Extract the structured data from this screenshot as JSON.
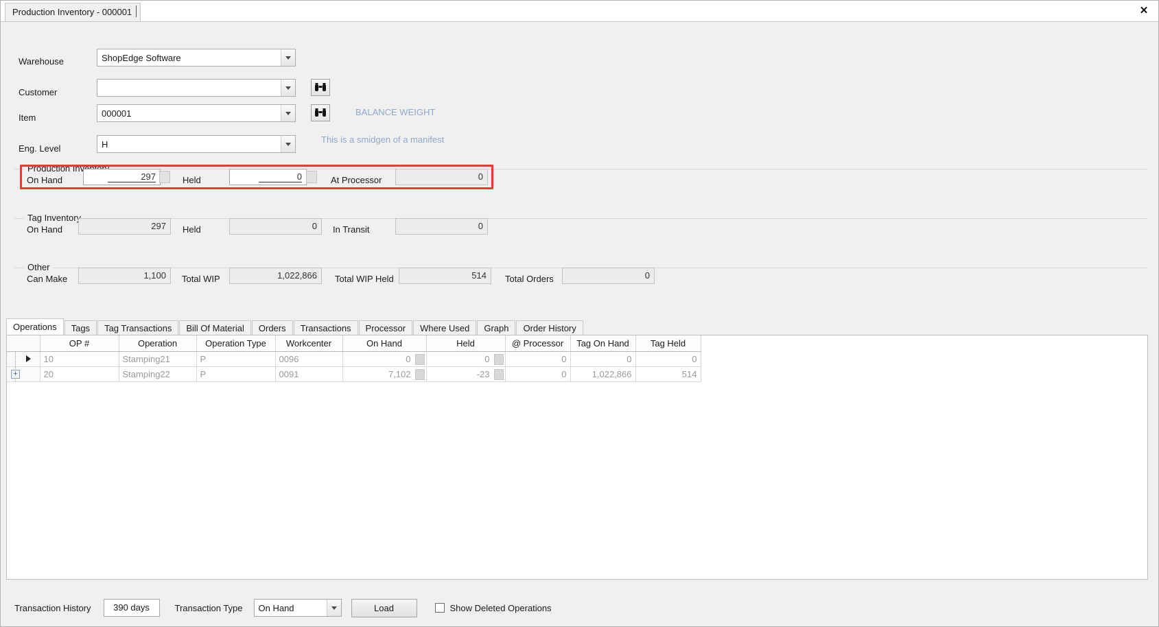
{
  "window": {
    "tab_title": "Production Inventory - 000001",
    "close_icon": "close-icon"
  },
  "form": {
    "warehouse": {
      "label": "Warehouse",
      "value": "ShopEdge Software"
    },
    "customer": {
      "label": "Customer",
      "value": "",
      "lookup_icon": "binoculars-icon"
    },
    "item": {
      "label": "Item",
      "value": "000001",
      "lookup_icon": "binoculars-icon",
      "hint": "BALANCE WEIGHT"
    },
    "eng_level": {
      "label": "Eng. Level",
      "value": "H",
      "hint": "This is a smidgen of a manifest"
    }
  },
  "production_inventory": {
    "title": "Production Inventory",
    "on_hand_label": "On Hand",
    "on_hand_value": "297",
    "held_label": "Held",
    "held_value": "0",
    "at_processor_label": "At Processor",
    "at_processor_value": "0",
    "highlight_color": "#ee3b30"
  },
  "tag_inventory": {
    "title": "Tag Inventory",
    "on_hand_label": "On Hand",
    "on_hand_value": "297",
    "held_label": "Held",
    "held_value": "0",
    "in_transit_label": "In Transit",
    "in_transit_value": "0"
  },
  "other": {
    "title": "Other",
    "can_make_label": "Can Make",
    "can_make_value": "1,100",
    "total_wip_label": "Total WIP",
    "total_wip_value": "1,022,866",
    "total_wip_held_label": "Total WIP Held",
    "total_wip_held_value": "514",
    "total_orders_label": "Total Orders",
    "total_orders_value": "0"
  },
  "tabs": [
    {
      "label": "Operations",
      "active": true
    },
    {
      "label": "Tags",
      "active": false
    },
    {
      "label": "Tag Transactions",
      "active": false
    },
    {
      "label": "Bill Of Material",
      "active": false
    },
    {
      "label": "Orders",
      "active": false
    },
    {
      "label": "Transactions",
      "active": false
    },
    {
      "label": "Processor",
      "active": false
    },
    {
      "label": "Where Used",
      "active": false
    },
    {
      "label": "Graph",
      "active": false
    },
    {
      "label": "Order History",
      "active": false
    }
  ],
  "grid": {
    "columns": [
      "OP #",
      "Operation",
      "Operation Type",
      "Workcenter",
      "On Hand",
      "Held",
      "@ Processor",
      "Tag On Hand",
      "Tag Held"
    ],
    "rows": [
      {
        "op": "10",
        "operation": "Stamping21",
        "operation_type": "P",
        "workcenter": "0096",
        "on_hand": "0",
        "held": "0",
        "at_processor": "0",
        "tag_on_hand": "0",
        "tag_held": "0",
        "selected": true
      },
      {
        "op": "20",
        "operation": "Stamping22",
        "operation_type": "P",
        "workcenter": "0091",
        "on_hand": "7,102",
        "held": "-23",
        "at_processor": "0",
        "tag_on_hand": "1,022,866",
        "tag_held": "514",
        "selected": false
      }
    ]
  },
  "bottom_bar": {
    "transaction_history_label": "Transaction History",
    "transaction_history_value": "390 days",
    "transaction_type_label": "Transaction Type",
    "transaction_type_value": "On Hand",
    "load_button": "Load",
    "show_deleted_label": "Show Deleted Operations",
    "show_deleted_checked": false
  }
}
